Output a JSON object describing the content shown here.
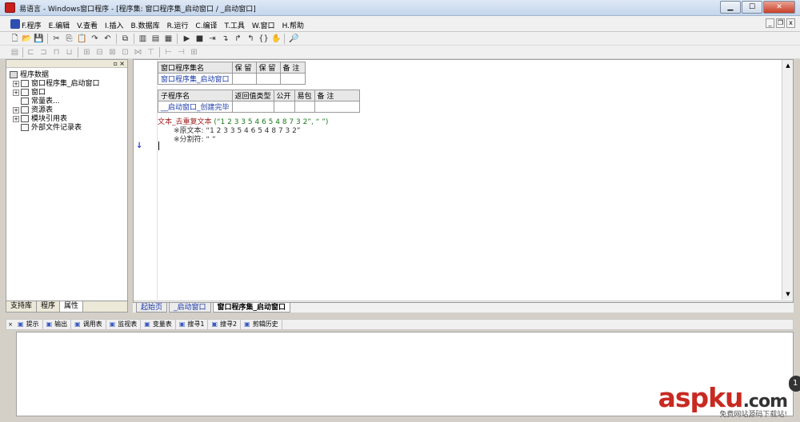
{
  "window": {
    "title": "易语言 - Windows窗口程序 - [程序集: 窗口程序集_启动窗口 / _启动窗口]",
    "minimize_label": "▁",
    "maximize_label": "☐",
    "close_label": "✕"
  },
  "menu": {
    "items": [
      "F.程序",
      "E.编辑",
      "V.查看",
      "I.插入",
      "B.数据库",
      "R.运行",
      "C.编译",
      "T.工具",
      "W.窗口",
      "H.帮助"
    ],
    "mdi_controls": [
      "_",
      "❐",
      "x"
    ]
  },
  "toolbar1": {
    "icons": [
      "new-file-icon",
      "open-folder-icon",
      "save-icon",
      "cut-icon",
      "copy-icon",
      "paste-icon",
      "redo-icon",
      "undo-icon",
      "find-icon",
      "layout-icon",
      "layout-icon",
      "layout-icon",
      "run-icon",
      "stop-icon",
      "step-icon",
      "step-into-icon",
      "step-out-icon",
      "braces-icon",
      "hand-icon",
      "debug-icon"
    ]
  },
  "left_panel": {
    "tree": [
      {
        "label": "程序数据",
        "level": 0,
        "expander": "",
        "icon": "database-icon"
      },
      {
        "label": "窗口程序集_启动窗口",
        "level": 1,
        "expander": "+",
        "icon": "module-icon"
      },
      {
        "label": "窗口",
        "level": 1,
        "expander": "+",
        "icon": "window-icon"
      },
      {
        "label": "常量表...",
        "level": 1,
        "expander": "",
        "icon": "constants-icon"
      },
      {
        "label": "资源表",
        "level": 1,
        "expander": "+",
        "icon": "resources-icon"
      },
      {
        "label": "模块引用表",
        "level": 1,
        "expander": "+",
        "icon": "modules-icon"
      },
      {
        "label": "外部文件记录表",
        "level": 1,
        "expander": "",
        "icon": "files-icon"
      }
    ],
    "tabs": [
      "支持库",
      "程序",
      "属性"
    ]
  },
  "editor": {
    "assembly_table": {
      "headers": [
        "窗口程序集名",
        "保 留",
        "保 留",
        "备 注"
      ],
      "row": [
        "窗口程序集_启动窗口",
        "",
        "",
        ""
      ]
    },
    "sub_table": {
      "headers": [
        "子程序名",
        "返回值类型",
        "公开",
        "易包",
        "备 注"
      ],
      "row": [
        "__启动窗口_创建完毕",
        "",
        "",
        "",
        ""
      ]
    },
    "code": {
      "line1_fn": "文本_去重复文本",
      "line1_args": " (“1 2 3 3 5 4 6 5 4 8 7 3 2”, “ ”)",
      "line2": "※原文本: “1 2 3 3 5 4 6 5 4 8 7 3 2”",
      "line3": "※分割符: “ ”"
    },
    "tabs": [
      "起始页",
      "_启动窗口",
      "窗口程序集_启动窗口"
    ]
  },
  "bottom_panel": {
    "tabs": [
      {
        "icon": "hint-icon",
        "label": "提示"
      },
      {
        "icon": "output-icon",
        "label": "输出"
      },
      {
        "icon": "calltable-icon",
        "label": "调用表"
      },
      {
        "icon": "monitor-icon",
        "label": "监视表"
      },
      {
        "icon": "variables-icon",
        "label": "变量表"
      },
      {
        "icon": "search-icon",
        "label": "搜寻1"
      },
      {
        "icon": "search-icon",
        "label": "搜寻2"
      },
      {
        "icon": "clipboard-icon",
        "label": "剪辑历史"
      }
    ]
  },
  "watermark": {
    "brand_a": "asp",
    "brand_b": "ku",
    "brand_c": ".com",
    "sub": "免费网站源码下载站!"
  },
  "colors": {
    "link_blue": "#1a3aa8",
    "function_red": "#a02020",
    "string_green": "#1a7a1a",
    "brand_red": "#c82a22"
  }
}
